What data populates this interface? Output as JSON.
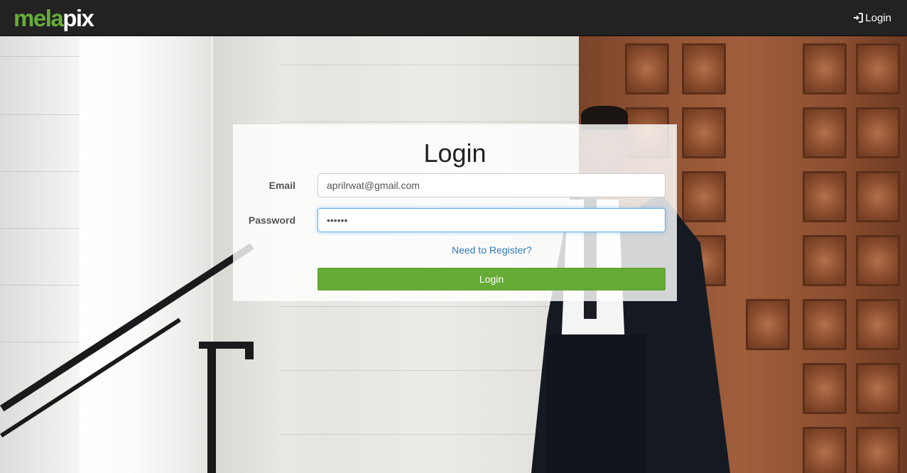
{
  "navbar": {
    "brand_part1": "mela",
    "brand_part2": "pix",
    "login_label": "Login",
    "login_icon": "sign-in-icon",
    "background_color": "#222222"
  },
  "login_form": {
    "title": "Login",
    "email_label": "Email",
    "email_value": "aprilrwat@gmail.com",
    "password_label": "Password",
    "password_value": "••••••",
    "register_link": "Need to Register?",
    "submit_label": "Login"
  },
  "colors": {
    "brand_green": "#67ad37",
    "button_green": "#67ab37",
    "link_blue": "#337ab7"
  }
}
